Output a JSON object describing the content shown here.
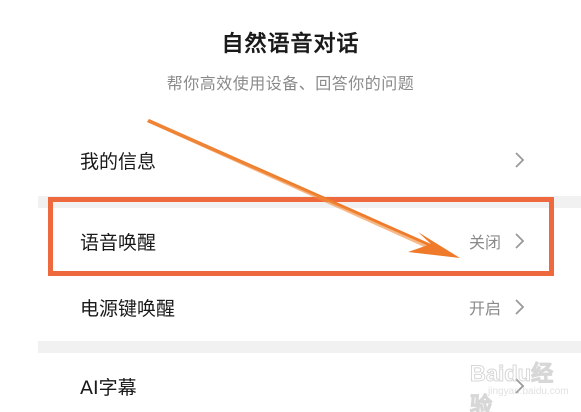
{
  "header": {
    "title": "自然语音对话",
    "subtitle": "帮你高效使用设备、回答你的问题"
  },
  "settings": {
    "items": [
      {
        "label": "我的信息",
        "value": ""
      },
      {
        "label": "语音唤醒",
        "value": "关闭"
      },
      {
        "label": "电源键唤醒",
        "value": "开启"
      },
      {
        "label": "AI字幕",
        "value": ""
      }
    ]
  },
  "annotation": {
    "highlight_color": "#ee6a3e",
    "arrow_color": "#ee7a2a"
  },
  "watermark": {
    "brand": "Baidu经验",
    "domain": "jingyan.baidu.com"
  },
  "icons": {
    "chevron": "chevron-right-icon"
  }
}
